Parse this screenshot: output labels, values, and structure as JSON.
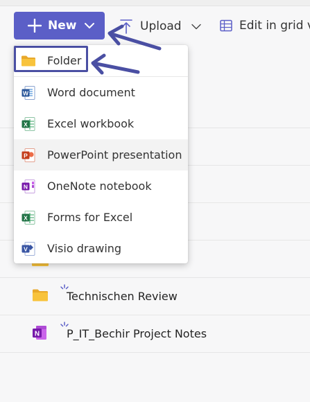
{
  "toolbar": {
    "new_label": "New",
    "upload_label": "Upload",
    "edit_grid_label": "Edit in grid vi"
  },
  "new_menu": {
    "items": [
      {
        "label": "Folder",
        "icon": "folder-icon"
      },
      {
        "label": "Word document",
        "icon": "word-icon"
      },
      {
        "label": "Excel workbook",
        "icon": "excel-icon"
      },
      {
        "label": "PowerPoint presentation",
        "icon": "powerpoint-icon"
      },
      {
        "label": "OneNote notebook",
        "icon": "onenote-icon"
      },
      {
        "label": "Forms for Excel",
        "icon": "forms-excel-icon"
      },
      {
        "label": "Visio drawing",
        "icon": "visio-icon"
      }
    ]
  },
  "files": [
    {
      "name": "Technischen Review",
      "icon": "folder-icon"
    },
    {
      "name": "P_IT_Bechir Project Notes",
      "icon": "onenote-icon"
    }
  ],
  "colors": {
    "accent": "#5b5fc7",
    "annotation_arrow": "#4a4fa3",
    "folder": "#f8c33c",
    "word": "#2b579a",
    "excel": "#217346",
    "powerpoint": "#c43e1c",
    "onenote": "#7719aa",
    "visio": "#3955a3"
  }
}
